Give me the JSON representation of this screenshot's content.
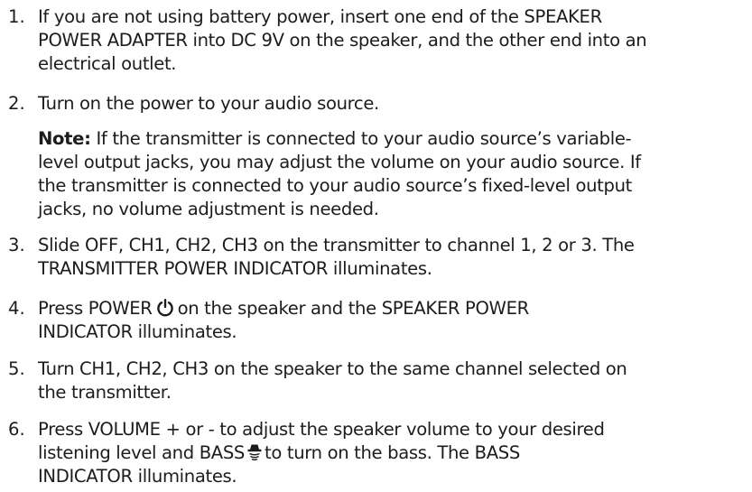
{
  "steps": [
    {
      "number": "1.",
      "lines": [
        "If you are not using battery power, insert one end of the SPEAKER",
        "POWER ADAPTER into DC 9V on the speaker, and the other end into an",
        "electrical outlet."
      ]
    },
    {
      "number": "2.",
      "lines": [
        "Turn on the power to your audio source."
      ]
    },
    {
      "number": "3.",
      "lines": [
        "Slide OFF, CH1, CH2, CH3 on the transmitter to channel 1, 2 or 3. The",
        "TRANSMITTER POWER INDICATOR illuminates."
      ]
    },
    {
      "number": "4.",
      "line1_before": "Press POWER",
      "line1_after": "on the speaker and the SPEAKER POWER",
      "line2": "INDICATOR illuminates."
    },
    {
      "number": "5.",
      "lines": [
        "Turn CH1, CH2, CH3 on the speaker to the same channel selected on",
        "the transmitter."
      ]
    },
    {
      "number": "6.",
      "line1": "Press VOLUME  + or - to adjust the speaker volume to your desired",
      "line2_before": "listening level and BASS",
      "line2_after": "to turn on the bass. The BASS",
      "line3": "INDICATOR illuminates."
    }
  ],
  "note": {
    "label": "Note:",
    "first_line": " If the transmitter is connected to your audio source’s variable-",
    "lines": [
      "level output jacks, you may adjust the volume on your audio source. If",
      "the transmitter is connected to your audio source’s fixed-level output",
      "jacks, no volume adjustment is needed."
    ]
  },
  "icons": {
    "power": "power-icon",
    "bass": "bass-icon",
    "color": "#1c1c1c"
  }
}
